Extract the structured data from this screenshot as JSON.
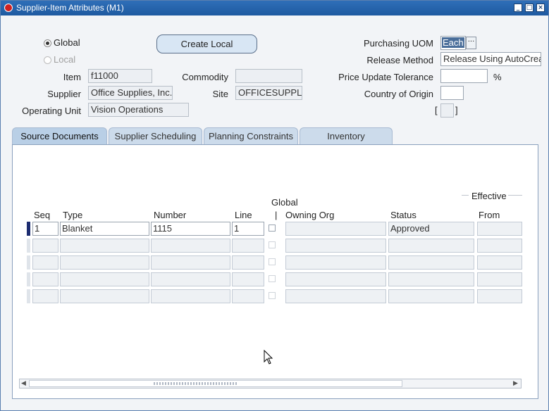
{
  "window": {
    "title": "Supplier-Item Attributes (M1)"
  },
  "scope": {
    "global_label": "Global",
    "local_label": "Local",
    "selected": "Global"
  },
  "create_local_label": "Create Local",
  "fields": {
    "item_label": "Item",
    "item_value": "f11000",
    "commodity_label": "Commodity",
    "commodity_value": "",
    "supplier_label": "Supplier",
    "supplier_value": "Office Supplies, Inc.",
    "site_label": "Site",
    "site_value": "OFFICESUPPL",
    "operating_unit_label": "Operating Unit",
    "operating_unit_value": "Vision Operations",
    "purchasing_uom_label": "Purchasing UOM",
    "purchasing_uom_value": "Each",
    "release_method_label": "Release Method",
    "release_method_value": "Release Using AutoCrea",
    "price_update_tolerance_label": "Price Update Tolerance",
    "price_update_tolerance_value": "",
    "percent_symbol": "%",
    "country_of_origin_label": "Country of Origin",
    "country_of_origin_value": "",
    "dff_open": "[",
    "dff_close": "]"
  },
  "tabs": [
    "Source Documents",
    "Supplier Scheduling",
    "Planning Constraints",
    "Inventory"
  ],
  "active_tab": "Source Documents",
  "table": {
    "headers": {
      "seq": "Seq",
      "type": "Type",
      "number": "Number",
      "line": "Line",
      "global": "Global",
      "global_sub": "|",
      "owning_org": "Owning Org",
      "status": "Status",
      "effective": "Effective",
      "from": "From"
    },
    "rows": [
      {
        "seq": "1",
        "type": "Blanket",
        "number": "1115",
        "line": "1",
        "global": false,
        "owning_org": "",
        "status": "Approved",
        "from": ""
      },
      {
        "seq": "",
        "type": "",
        "number": "",
        "line": "",
        "global": false,
        "owning_org": "",
        "status": "",
        "from": ""
      },
      {
        "seq": "",
        "type": "",
        "number": "",
        "line": "",
        "global": false,
        "owning_org": "",
        "status": "",
        "from": ""
      },
      {
        "seq": "",
        "type": "",
        "number": "",
        "line": "",
        "global": false,
        "owning_org": "",
        "status": "",
        "from": ""
      },
      {
        "seq": "",
        "type": "",
        "number": "",
        "line": "",
        "global": false,
        "owning_org": "",
        "status": "",
        "from": ""
      }
    ]
  },
  "colors": {
    "titlebar": "#2f6fb8",
    "tab_active": "#b9cfe6",
    "tab": "#ccdbeb",
    "row_indicator": "#1c2c70"
  }
}
